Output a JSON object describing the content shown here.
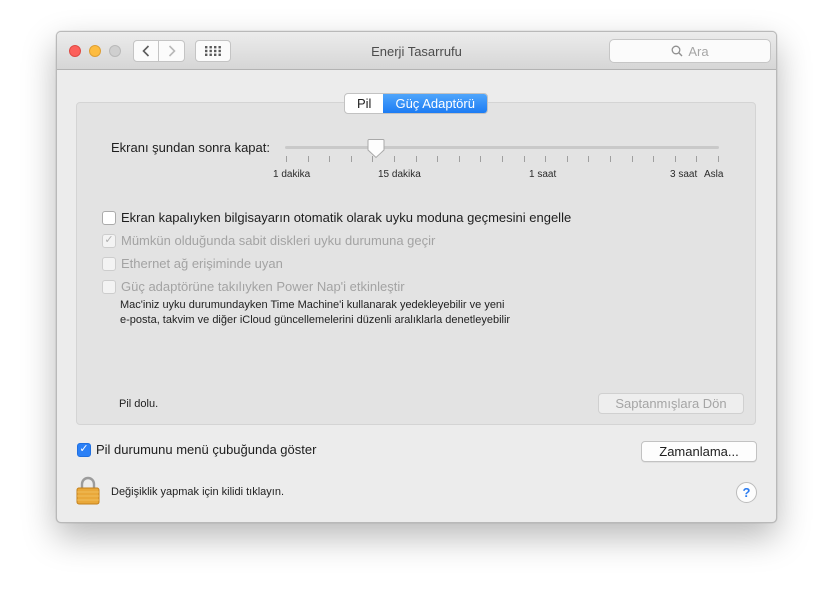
{
  "window": {
    "title": "Enerji Tasarrufu"
  },
  "search": {
    "placeholder": "Ara"
  },
  "tabs": [
    {
      "label": "Pil",
      "active": false
    },
    {
      "label": "Güç Adaptörü",
      "active": true
    }
  ],
  "slider": {
    "label": "Ekranı şundan sonra kapat:",
    "value_label": "15 dakika",
    "ticks": [
      "1 dakika",
      "15 dakika",
      "1 saat",
      "3 saat",
      "Asla"
    ]
  },
  "options": [
    {
      "label": "Ekran kapalıyken bilgisayarın otomatik olarak uyku moduna geçmesini engelle",
      "checked": false,
      "enabled": true
    },
    {
      "label": "Mümkün olduğunda sabit diskleri uyku durumuna geçir",
      "checked": true,
      "enabled": false
    },
    {
      "label": "Ethernet ağ erişiminde uyan",
      "checked": false,
      "enabled": false
    },
    {
      "label": "Güç adaptörüne takılıyken Power Nap'i etkinleştir",
      "checked": false,
      "enabled": false
    }
  ],
  "power_nap_description": [
    "Mac'iniz uyku durumundayken Time Machine'i kullanarak yedekleyebilir ve yeni",
    "e-posta, takvim ve diğer iCloud güncellemelerini düzenli aralıklarla denetleyebilir"
  ],
  "battery_status": "Pil dolu.",
  "restore_defaults_label": "Saptanmışlara Dön",
  "show_battery_menu": {
    "label": "Pil durumunu menü çubuğunda göster",
    "checked": true
  },
  "schedule_label": "Zamanlama...",
  "lock_text": "Değişiklik yapmak için kilidi tıklayın.",
  "help_label": "?",
  "colors": {
    "accent": "#2b80f6",
    "lock": "#e9a83a"
  }
}
